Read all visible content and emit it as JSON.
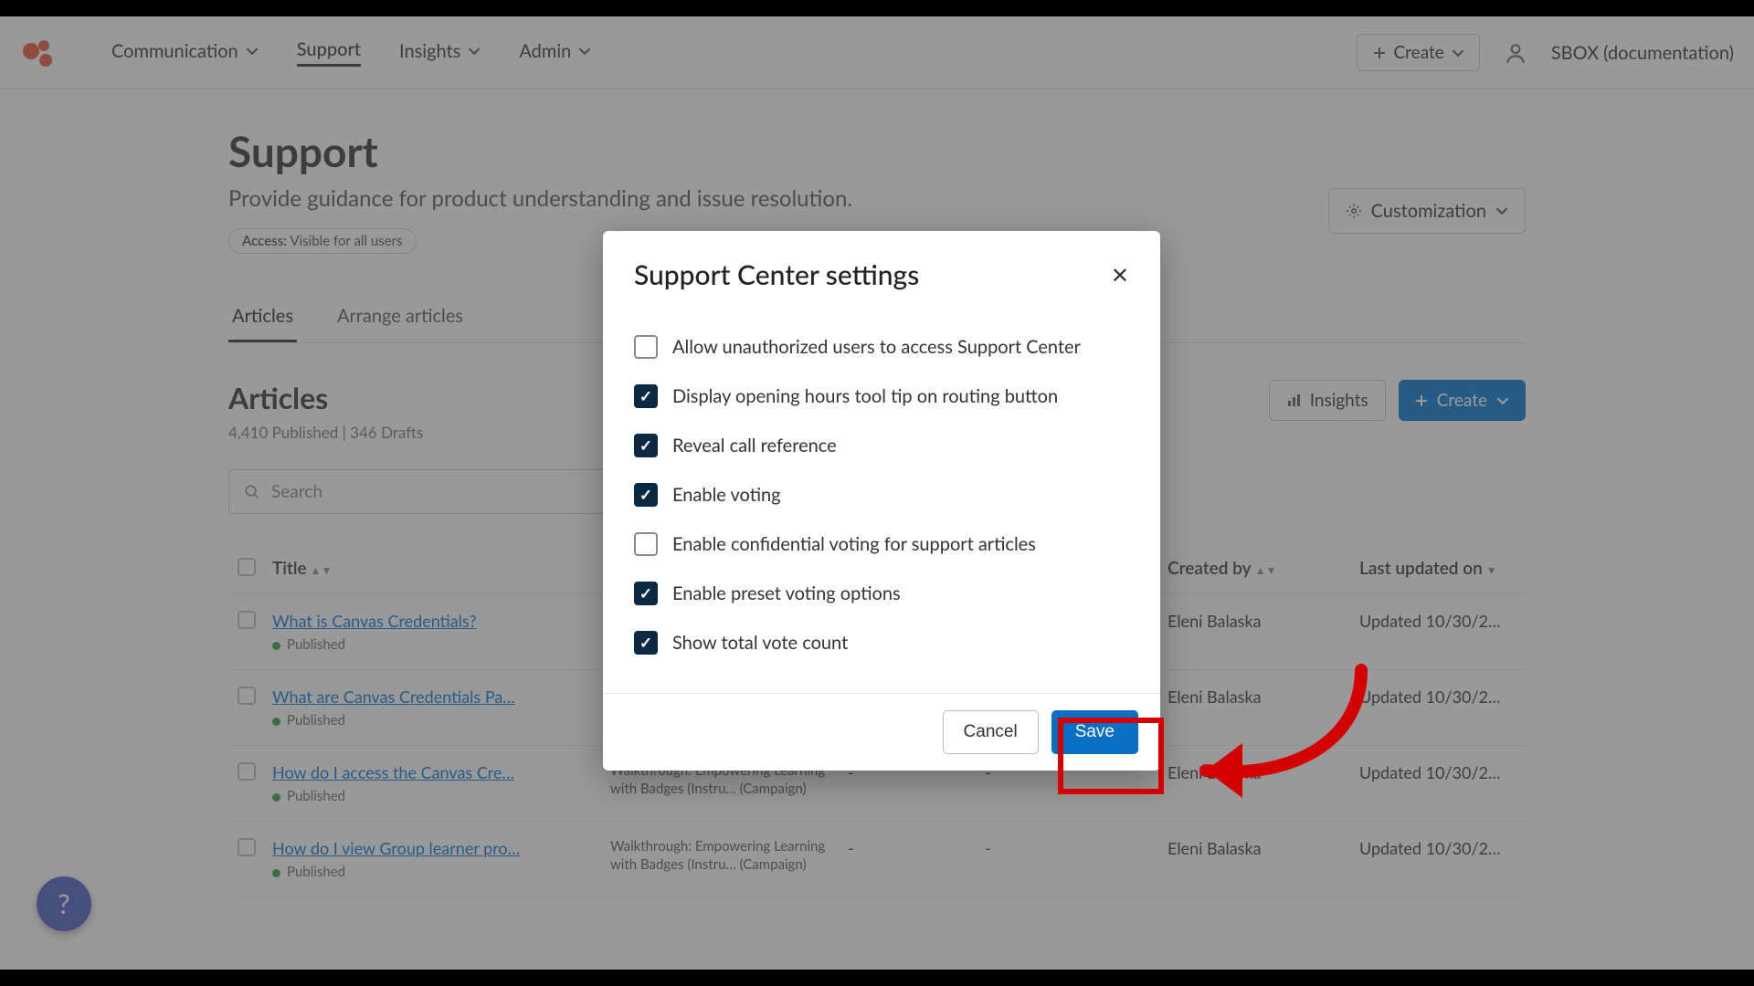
{
  "topbar": {
    "nav": [
      "Communication",
      "Support",
      "Insights",
      "Admin"
    ],
    "create": "Create",
    "tenant": "SBOX (documentation)"
  },
  "page": {
    "title": "Support",
    "subtitle": "Provide guidance for product understanding and issue resolution.",
    "access_label": "Access:",
    "access_value": "Visible for all users",
    "customization": "Customization"
  },
  "tabs": {
    "articles": "Articles",
    "arrange": "Arrange articles"
  },
  "section": {
    "title": "Articles",
    "counts": "4,410 Published  |  346 Drafts",
    "insights": "Insights",
    "create": "Create"
  },
  "search": {
    "placeholder": "Search"
  },
  "columns": {
    "title": "Title",
    "created": "Created by",
    "updated": "Last updated on"
  },
  "rows": [
    {
      "title": "What is Canvas Credentials?",
      "status": "Published",
      "category": "",
      "votes": "",
      "rating": "",
      "by": "Eleni Balaska",
      "upd": "Updated 10/30/2…"
    },
    {
      "title": "What are Canvas Credentials Pa…",
      "status": "Published",
      "category": "",
      "votes": "-",
      "rating": "-",
      "by": "Eleni Balaska",
      "upd": "Updated 10/30/2…"
    },
    {
      "title": "How do I access the Canvas Cre…",
      "status": "Published",
      "category": "Walkthrough: Empowering Learning with Badges (Instru… (Campaign)",
      "votes": "-",
      "rating": "-",
      "by": "Eleni Balaska",
      "upd": "Updated 10/30/2…"
    },
    {
      "title": "How do I view Group learner pro…",
      "status": "Published",
      "category": "Walkthrough: Empowering Learning with Badges (Instru… (Campaign)",
      "votes": "-",
      "rating": "-",
      "by": "Eleni Balaska",
      "upd": "Updated 10/30/2…"
    }
  ],
  "modal": {
    "title": "Support Center settings",
    "cancel": "Cancel",
    "save": "Save",
    "options": [
      {
        "label": "Allow unauthorized users to access Support Center",
        "checked": false
      },
      {
        "label": "Display opening hours tool tip on routing button",
        "checked": true
      },
      {
        "label": "Reveal call reference",
        "checked": true
      },
      {
        "label": "Enable voting",
        "checked": true
      },
      {
        "label": "Enable confidential voting for support articles",
        "checked": false
      },
      {
        "label": "Enable preset voting options",
        "checked": true
      },
      {
        "label": "Show total vote count",
        "checked": true
      }
    ]
  },
  "help": "?"
}
